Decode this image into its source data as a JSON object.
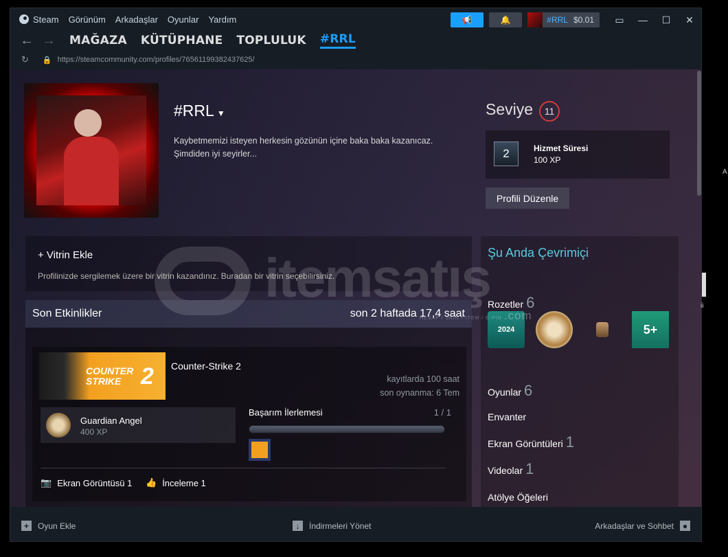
{
  "menubar": {
    "steam": "Steam",
    "items": [
      "Görünüm",
      "Arkadaşlar",
      "Oyunlar",
      "Yardım"
    ],
    "account_name": "#RRL",
    "wallet": "$0.01"
  },
  "nav": {
    "links": [
      "MAĞAZA",
      "KÜTÜPHANE",
      "TOPLULUK",
      "#RRL"
    ],
    "url": "https://steamcommunity.com/profiles/76561199382437625/"
  },
  "profile": {
    "name": "#RRL",
    "summary": "Kaybetmemizi isteyen herkesin gözünün içine baka baka kazanıcaz. Şimdiden iyi seyirler...",
    "level_label": "Seviye",
    "level": "11",
    "badge_num": "2",
    "badge_title": "Hizmet Süresi",
    "badge_xp": "100 XP",
    "edit_button": "Profili Düzenle"
  },
  "showcase": {
    "title": "+ Vitrin Ekle",
    "desc": "Profilinizde sergilemek üzere bir vitrin kazandınız. Buradan bir vitrin seçebilirsiniz."
  },
  "activity": {
    "header": "Son Etkinlikler",
    "hours": "son 2 haftada 17,4 saat",
    "game": {
      "capsule_text": "COUNTER STRIKE",
      "capsule_num": "2",
      "name": "Counter-Strike 2",
      "total": "kayıtlarda 100 saat",
      "last": "son oynanma: 6 Tem",
      "ach_name": "Guardian Angel",
      "ach_xp": "400 XP",
      "prog_label": "Başarım İlerlemesi",
      "prog_count": "1 / 1",
      "prog_frac": 1.0,
      "screenshot": "Ekran Görüntüsü 1",
      "review": "İnceleme 1"
    }
  },
  "right": {
    "online": "Şu Anda Çevrimiçi",
    "badges_label": "Rozetler",
    "badges_count": "6",
    "badge_year": "2024",
    "badge_5": "5+",
    "games_label": "Oyunlar",
    "games_count": "6",
    "inventory": "Envanter",
    "screenshots_label": "Ekran Görüntüleri",
    "screenshots_count": "1",
    "videos_label": "Videolar",
    "videos_count": "1",
    "workshop": "Atölye Öğeleri"
  },
  "watermark": {
    "text": "itemsatış",
    "sub": "HESAP / SKIN / ITEM / E-PIN",
    "com": ".com"
  },
  "bottombar": {
    "add_game": "Oyun Ekle",
    "downloads": "İndirmeleri Yönet",
    "friends": "Arkadaşlar ve Sohbet"
  },
  "outside": {
    "a": "A",
    "i": "ii"
  }
}
